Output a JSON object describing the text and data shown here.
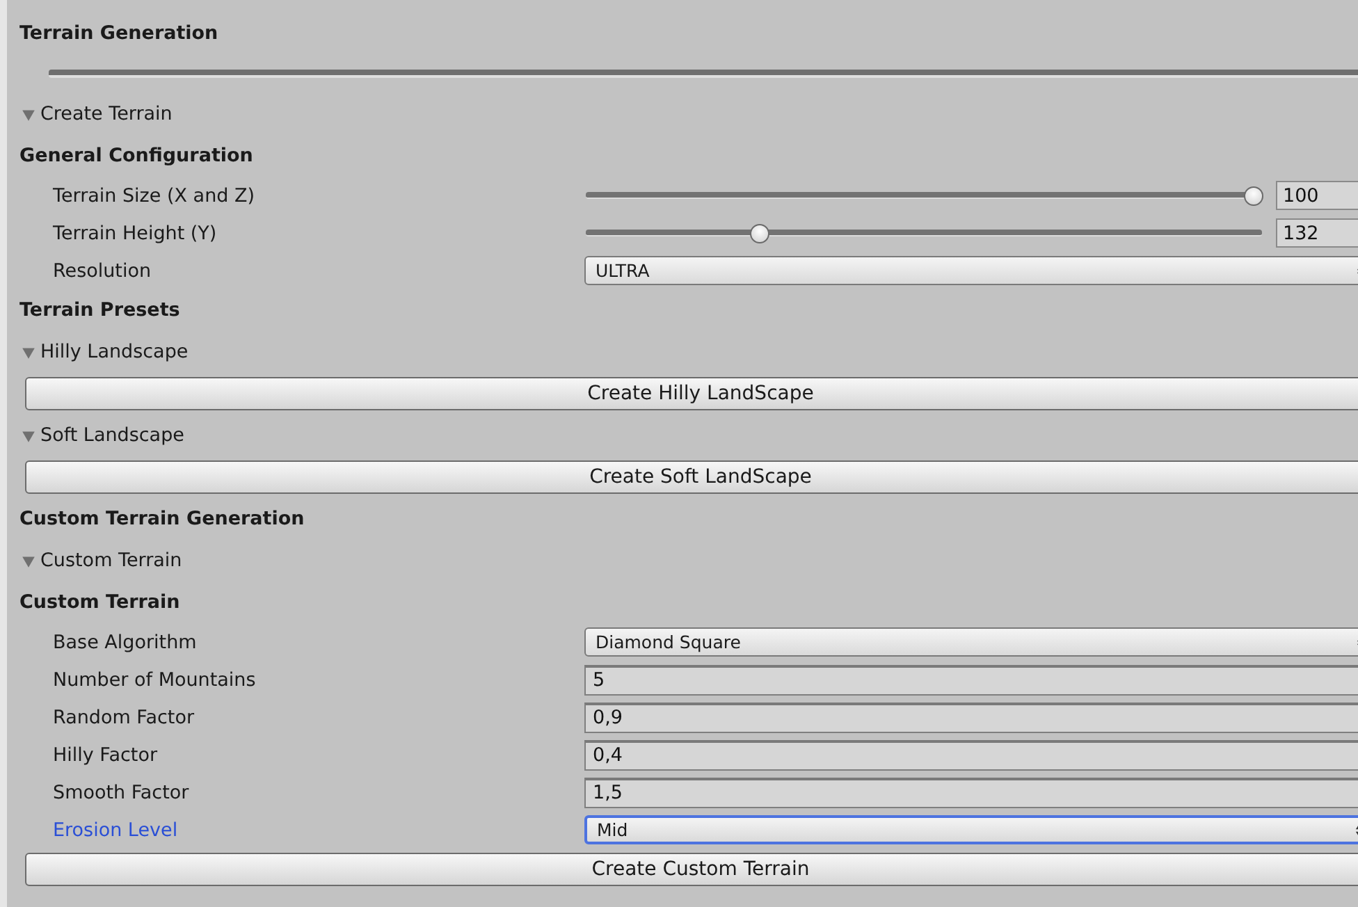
{
  "rows": [
    {
      "kind": "heading",
      "text": "Terrain Generation"
    },
    {
      "kind": "separator"
    },
    {
      "kind": "foldout",
      "text": "Create Terrain",
      "expanded": true
    },
    {
      "kind": "heading",
      "text": "General Configuration"
    },
    {
      "kind": "slider",
      "label": "Terrain Size (X and Z)",
      "level": 1,
      "value": "100"
    },
    {
      "kind": "slider",
      "label": "Terrain Height (Y)",
      "level": 0.25,
      "value": "132"
    },
    {
      "kind": "dropdown",
      "label": "Resolution",
      "value": "ULTRA",
      "focused": false
    },
    {
      "kind": "heading",
      "text": "Terrain Presets"
    },
    {
      "kind": "foldout",
      "text": "Hilly Landscape",
      "expanded": true
    },
    {
      "kind": "button",
      "text": "Create Hilly LandScape"
    },
    {
      "kind": "foldout",
      "text": "Soft Landscape",
      "expanded": true
    },
    {
      "kind": "button",
      "text": "Create Soft LandScape"
    },
    {
      "kind": "heading",
      "text": "Custom Terrain Generation"
    },
    {
      "kind": "foldout",
      "text": "Custom Terrain",
      "expanded": true
    },
    {
      "kind": "heading",
      "text": "Custom Terrain"
    },
    {
      "kind": "dropdown",
      "label": "Base Algorithm",
      "value": "Diamond Square",
      "focused": false
    },
    {
      "kind": "field",
      "label": "Number of Mountains",
      "value": "5"
    },
    {
      "kind": "field",
      "label": "Random Factor",
      "value": "0,9"
    },
    {
      "kind": "field",
      "label": "Hilly Factor",
      "value": "0,4"
    },
    {
      "kind": "field",
      "label": "Smooth Factor",
      "value": "1,5"
    },
    {
      "kind": "dropdown",
      "label": "Erosion Level",
      "value": "Mid",
      "focused": true
    },
    {
      "kind": "button",
      "text": "Create Custom Terrain"
    }
  ]
}
